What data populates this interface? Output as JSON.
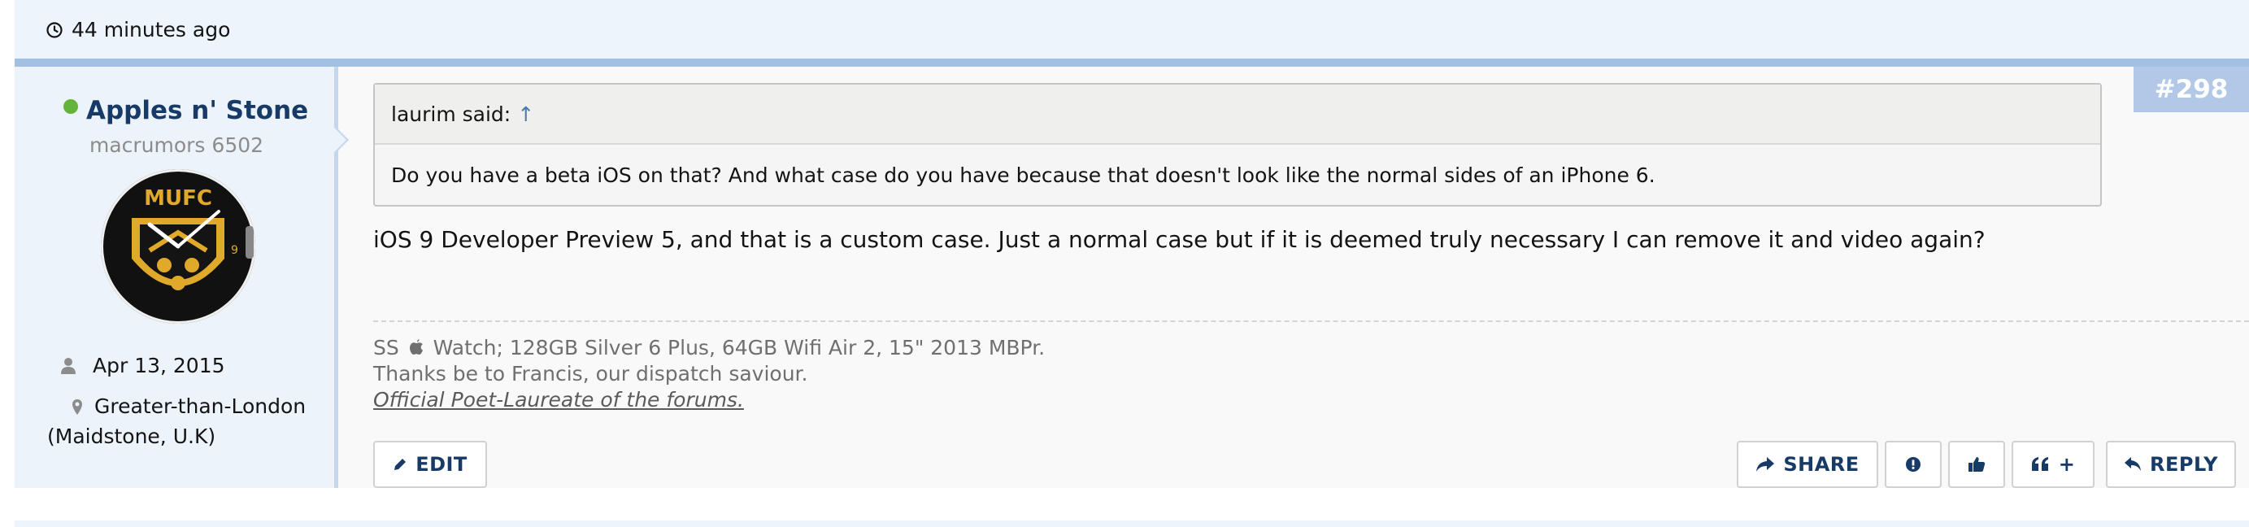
{
  "header": {
    "time_text": "44 minutes ago"
  },
  "post": {
    "number": "#298",
    "author": {
      "name": "Apples n' Stone",
      "title": "macrumors 6502",
      "joined": "Apr 13, 2015",
      "location": "Greater-than-London (Maidstone, U.K)",
      "online": true,
      "avatar_text": "MUFC"
    },
    "quote": {
      "author": "laurim said:",
      "arrow": "↑",
      "text": "Do you have a beta iOS on that? And what case do you have because that doesn't look like the normal sides of an iPhone 6."
    },
    "message": "iOS 9 Developer Preview 5, and that is a custom case. Just a normal case but if it is deemed truly necessary I can remove it and video again?",
    "signature": {
      "line1_prefix": "SS",
      "line1_suffix": "Watch; 128GB Silver 6 Plus, 64GB Wifi Air 2, 15\" 2013 MBPr.",
      "line2": "Thanks be to Francis, our dispatch saviour.",
      "line3": "Official Poet-Laureate of the forums."
    },
    "actions": {
      "edit": "EDIT",
      "share": "SHARE",
      "multiquote": "+",
      "reply": "REPLY"
    }
  },
  "colors": {
    "accent": "#183a66",
    "online": "#63b33c",
    "badge_bg": "#b2c8e6",
    "post_border": "#a3bfe1"
  },
  "icons": {
    "time": "clock-icon",
    "joined": "user-icon",
    "location": "map-marker-icon",
    "edit": "pencil-icon",
    "share": "share-arrow-icon",
    "report": "exclamation-icon",
    "like": "thumbs-up-icon",
    "multiquote": "quote-icon",
    "reply": "reply-arrow-icon"
  }
}
